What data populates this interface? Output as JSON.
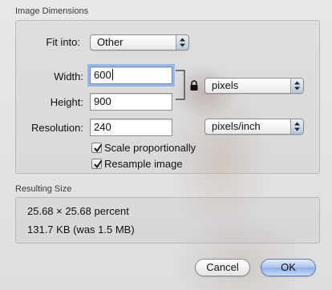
{
  "image_dimensions": {
    "title": "Image Dimensions",
    "fit_into": {
      "label": "Fit into:",
      "value": "Other"
    },
    "width": {
      "label": "Width:",
      "value": "600"
    },
    "height": {
      "label": "Height:",
      "value": "900"
    },
    "unit_popup": {
      "value": "pixels"
    },
    "resolution": {
      "label": "Resolution:",
      "value": "240",
      "unit": "pixels/inch"
    },
    "scale_proportionally": {
      "label": "Scale proportionally",
      "checked": true
    },
    "resample_image": {
      "label": "Resample image",
      "checked": true
    },
    "lock_icon": "lock-icon"
  },
  "resulting_size": {
    "title": "Resulting Size",
    "percent": "25.68 × 25.68 percent",
    "size": "131.7 KB (was 1.5 MB)"
  },
  "buttons": {
    "cancel": "Cancel",
    "ok": "OK"
  },
  "colors": {
    "focus_ring": "#6d8fc9",
    "default_button": "#8fb0e6"
  }
}
